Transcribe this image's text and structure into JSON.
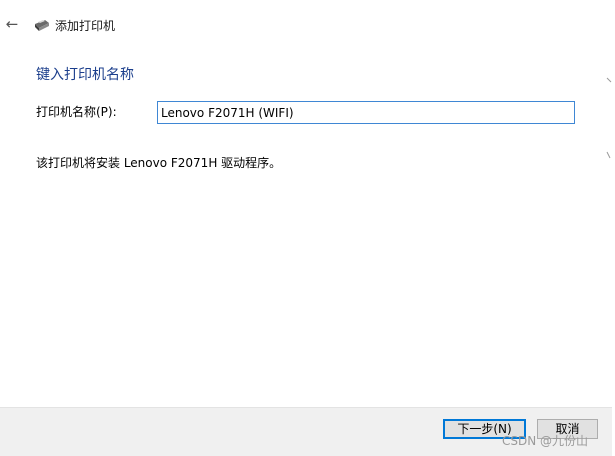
{
  "wizard": {
    "title": "添加打印机",
    "back_icon": "←",
    "heading": "键入打印机名称",
    "printer_name_label": "打印机名称(P):",
    "printer_name_value": "Lenovo F2071H (WIFI)",
    "driver_info": "该打印机将安装 Lenovo F2071H 驱动程序。"
  },
  "footer": {
    "next_label": "下一步(N)",
    "cancel_label": "取消",
    "watermark": "CSDN @九份山"
  },
  "colors": {
    "heading": "#1b3e8c",
    "focus_border": "#3f87d4",
    "footer_bg": "#f0f0f0"
  }
}
